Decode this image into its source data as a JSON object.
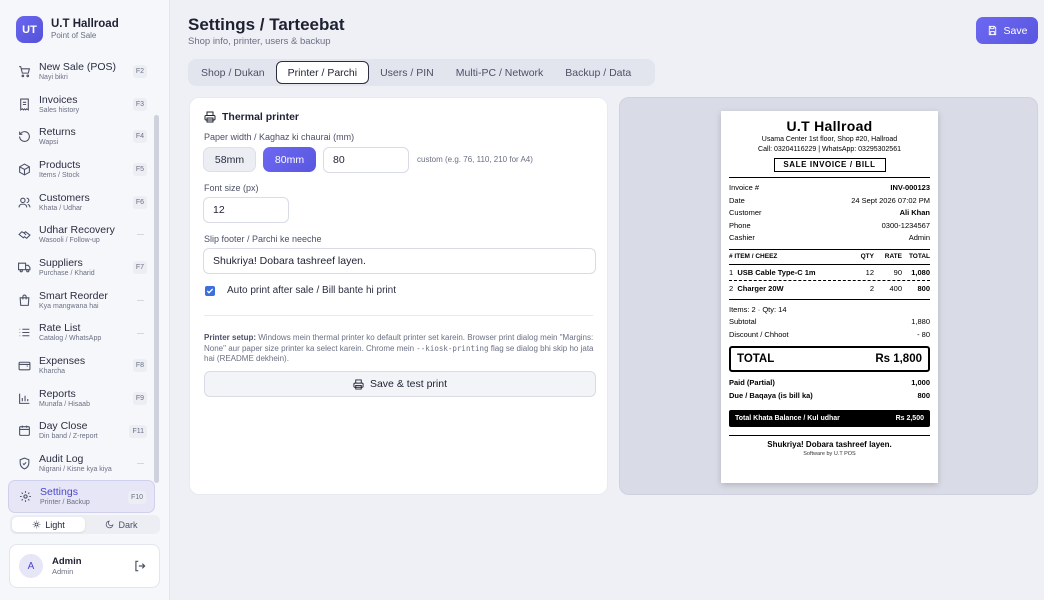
{
  "brand": {
    "logo": "UT",
    "name": "U.T Hallroad",
    "sub": "Point of Sale"
  },
  "sidebar": {
    "items": [
      {
        "label": "New Sale (POS)",
        "sub": "Nayi bikri",
        "key": "F2",
        "icon": "cart-icon"
      },
      {
        "label": "Invoices",
        "sub": "Sales history",
        "key": "F3",
        "icon": "receipt-icon"
      },
      {
        "label": "Returns",
        "sub": "Wapsi",
        "key": "F4",
        "icon": "undo-icon"
      },
      {
        "label": "Products",
        "sub": "Items / Stock",
        "key": "F5",
        "icon": "box-icon"
      },
      {
        "label": "Customers",
        "sub": "Khata / Udhar",
        "key": "F6",
        "icon": "users-icon"
      },
      {
        "label": "Udhar Recovery",
        "sub": "Wasooli / Follow-up",
        "key": "—",
        "icon": "handshake-icon"
      },
      {
        "label": "Suppliers",
        "sub": "Purchase / Kharid",
        "key": "F7",
        "icon": "truck-icon"
      },
      {
        "label": "Smart Reorder",
        "sub": "Kya mangwana hai",
        "key": "—",
        "icon": "bag-icon"
      },
      {
        "label": "Rate List",
        "sub": "Catalog / WhatsApp",
        "key": "—",
        "icon": "list-icon"
      },
      {
        "label": "Expenses",
        "sub": "Kharcha",
        "key": "F8",
        "icon": "wallet-icon"
      },
      {
        "label": "Reports",
        "sub": "Munafa / Hisaab",
        "key": "F9",
        "icon": "chart-icon"
      },
      {
        "label": "Day Close",
        "sub": "Din band / Z-report",
        "key": "F11",
        "icon": "calendar-icon"
      },
      {
        "label": "Audit Log",
        "sub": "Nigrani / Kisne kya kiya",
        "key": "—",
        "icon": "shield-icon"
      },
      {
        "label": "Settings",
        "sub": "Printer / Backup",
        "key": "F10",
        "icon": "gear-icon"
      }
    ],
    "theme": {
      "light": "Light",
      "dark": "Dark"
    },
    "user": {
      "initial": "A",
      "name": "Admin",
      "role": "Admin"
    }
  },
  "header": {
    "title": "Settings / Tarteebat",
    "subtitle": "Shop info, printer, users & backup",
    "save_label": "Save"
  },
  "tabs": [
    "Shop / Dukan",
    "Printer / Parchi",
    "Users / PIN",
    "Multi-PC / Network",
    "Backup / Data"
  ],
  "printer": {
    "title": "Thermal printer",
    "paper_label": "Paper width / Kaghaz ki chaurai (mm)",
    "opt_58": "58mm",
    "opt_80": "80mm",
    "custom_value": "80",
    "custom_hint": "custom (e.g. 76, 110, 210 for A4)",
    "font_label": "Font size (px)",
    "font_value": "12",
    "footer_label": "Slip footer / Parchi ke neeche",
    "footer_value": "Shukriya! Dobara tashreef layen.",
    "auto_print_label": "Auto print after sale / Bill bante hi print",
    "setup_title": "Printer setup:",
    "setup_text_1": "Windows mein thermal printer ko default printer set karein. Browser print dialog mein \"Margins: None\" aur paper size printer ka select karein. Chrome mein",
    "setup_code": "--kiosk-printing",
    "setup_text_2": "flag se dialog bhi skip ho jata hai (README dekhein).",
    "test_label": "Save & test print"
  },
  "receipt": {
    "shop": "U.T Hallroad",
    "address": "Usama Center 1st floor, Shop #20, Hallroad",
    "contact": "Call: 03204116229 | WhatsApp: 03295302561",
    "tag": "SALE INVOICE / BILL",
    "info": [
      {
        "k": "Invoice #",
        "v": "INV-000123",
        "bold": true
      },
      {
        "k": "Date",
        "v": "24 Sept 2026 07:02 PM",
        "bold": false
      },
      {
        "k": "Customer",
        "v": "Ali Khan",
        "bold": true
      },
      {
        "k": "Phone",
        "v": "0300-1234567",
        "bold": false
      },
      {
        "k": "Cashier",
        "v": "Admin",
        "bold": false
      }
    ],
    "cols": {
      "item": "# ITEM / CHEEZ",
      "qty": "QTY",
      "rate": "RATE",
      "total": "TOTAL"
    },
    "lines": [
      {
        "n": "1",
        "name": "USB Cable Type-C 1m",
        "qty": "12",
        "rate": "90",
        "total": "1,080"
      },
      {
        "n": "2",
        "name": "Charger 20W",
        "qty": "2",
        "rate": "400",
        "total": "800"
      }
    ],
    "items_count": "Items: 2 · Qty: 14",
    "subtotal_label": "Subtotal",
    "subtotal": "1,880",
    "discount_label": "Discount / Chhoot",
    "discount": "- 80",
    "total_label": "TOTAL",
    "total": "Rs 1,800",
    "paid_label": "Paid (Partial)",
    "paid": "1,000",
    "due_label": "Due / Baqaya (is bill ka)",
    "due": "800",
    "khata_label": "Total Khata Balance / Kul udhar",
    "khata": "Rs 2,500",
    "thanks": "Shukriya! Dobara tashreef layen.",
    "software": "Software by U.T POS"
  },
  "colors": {
    "accent": "#5f5ce8",
    "active_nav_bg": "#e6e6f7",
    "checkbox": "#3b6fe0"
  }
}
